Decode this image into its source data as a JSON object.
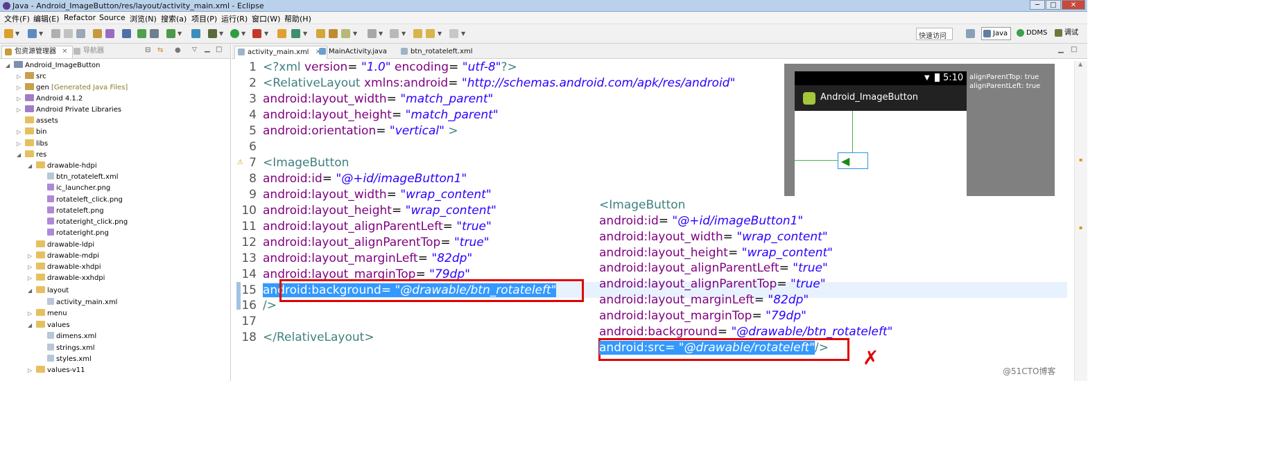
{
  "window": {
    "title": "Java - Android_ImageButton/res/layout/activity_main.xml - Eclipse",
    "min": "─",
    "max": "□",
    "close": "✕"
  },
  "menu": [
    "文件(F)",
    "编辑(E)",
    "Refactor",
    "Source",
    "浏览(N)",
    "搜索(a)",
    "项目(P)",
    "运行(R)",
    "窗口(W)",
    "帮助(H)"
  ],
  "toolbar": {
    "quick_access": "快速访问",
    "perspectives": {
      "java": "Java",
      "ddms": "DDMS",
      "debug": "调试"
    }
  },
  "left_panel": {
    "tabs": {
      "package_explorer": "包资源管理器",
      "navigator": "导航器"
    }
  },
  "tree": [
    {
      "label": "Android_ImageButton"
    },
    {
      "label": "src"
    },
    {
      "label": "gen",
      "deco": "[Generated Java Files]"
    },
    {
      "label": "Android 4.1.2"
    },
    {
      "label": "Android Private Libraries"
    },
    {
      "label": "assets"
    },
    {
      "label": "bin"
    },
    {
      "label": "libs"
    },
    {
      "label": "res"
    },
    {
      "label": "drawable-hdpi"
    },
    {
      "label": "btn_rotateleft.xml"
    },
    {
      "label": "ic_launcher.png"
    },
    {
      "label": "rotateleft_click.png"
    },
    {
      "label": "rotateleft.png"
    },
    {
      "label": "rotateright_click.png"
    },
    {
      "label": "rotateright.png"
    },
    {
      "label": "drawable-ldpi"
    },
    {
      "label": "drawable-mdpi"
    },
    {
      "label": "drawable-xhdpi"
    },
    {
      "label": "drawable-xxhdpi"
    },
    {
      "label": "layout"
    },
    {
      "label": "activity_main.xml"
    },
    {
      "label": "menu"
    },
    {
      "label": "values"
    },
    {
      "label": "dimens.xml"
    },
    {
      "label": "strings.xml"
    },
    {
      "label": "styles.xml"
    },
    {
      "label": "values-v11"
    }
  ],
  "editor": {
    "tabs": [
      "activity_main.xml",
      "MainActivity.java",
      "btn_rotateleft.xml"
    ],
    "lines": [
      {
        "n": "1",
        "p": [
          [
            "tag",
            "<?xml "
          ],
          [
            "attr",
            "version"
          ],
          [
            "p",
            "= "
          ],
          [
            "val",
            "\"1.0\""
          ],
          [
            "p",
            " "
          ],
          [
            "attr",
            "encoding"
          ],
          [
            "p",
            "= "
          ],
          [
            "val",
            "\"utf-8\""
          ],
          [
            "tag",
            "?>"
          ]
        ]
      },
      {
        "n": "2",
        "p": [
          [
            "tag",
            "<RelativeLayout "
          ],
          [
            "attr",
            "xmlns:android"
          ],
          [
            "p",
            "= "
          ],
          [
            "val",
            "\"http://schemas.android.com/apk/res/android\""
          ]
        ]
      },
      {
        "n": "3",
        "p": [
          [
            "attr",
            "   android:layout_width"
          ],
          [
            "p",
            "= "
          ],
          [
            "val",
            "\"match_parent\""
          ]
        ]
      },
      {
        "n": "4",
        "p": [
          [
            "attr",
            "   android:layout_height"
          ],
          [
            "p",
            "= "
          ],
          [
            "val",
            "\"match_parent\""
          ]
        ]
      },
      {
        "n": "5",
        "p": [
          [
            "attr",
            "   android:orientation"
          ],
          [
            "p",
            "= "
          ],
          [
            "val",
            "\"vertical\""
          ],
          [
            "tag",
            " >"
          ]
        ]
      },
      {
        "n": "6",
        "p": []
      },
      {
        "n": "7",
        "p": [
          [
            "tag",
            "    <ImageButton"
          ]
        ]
      },
      {
        "n": "8",
        "p": [
          [
            "attr",
            "       android:id"
          ],
          [
            "p",
            "= "
          ],
          [
            "val",
            "\"@+id/imageButton1\""
          ]
        ]
      },
      {
        "n": "9",
        "p": [
          [
            "attr",
            "       android:layout_width"
          ],
          [
            "p",
            "= "
          ],
          [
            "val",
            "\"wrap_content\""
          ]
        ]
      },
      {
        "n": "10",
        "p": [
          [
            "attr",
            "       android:layout_height"
          ],
          [
            "p",
            "= "
          ],
          [
            "val",
            "\"wrap_content\""
          ]
        ]
      },
      {
        "n": "11",
        "p": [
          [
            "attr",
            "       android:layout_alignParentLeft"
          ],
          [
            "p",
            "= "
          ],
          [
            "val",
            "\"true\""
          ]
        ]
      },
      {
        "n": "12",
        "p": [
          [
            "attr",
            "       android:layout_alignParentTop"
          ],
          [
            "p",
            "= "
          ],
          [
            "val",
            "\"true\""
          ]
        ]
      },
      {
        "n": "13",
        "p": [
          [
            "attr",
            "       android:layout_marginLeft"
          ],
          [
            "p",
            "= "
          ],
          [
            "val",
            "\"82dp\""
          ]
        ]
      },
      {
        "n": "14",
        "p": [
          [
            "attr",
            "       android:layout_marginTop"
          ],
          [
            "p",
            "= "
          ],
          [
            "val",
            "\"79dp\""
          ]
        ]
      },
      {
        "n": "15",
        "p": [
          [
            "attr",
            "       android:background"
          ],
          [
            "p",
            "= "
          ],
          [
            "val",
            "\"@drawable/btn_rotateleft\""
          ]
        ]
      },
      {
        "n": "16",
        "p": [
          [
            "tag",
            "       />"
          ]
        ]
      },
      {
        "n": "17",
        "p": []
      },
      {
        "n": "18",
        "p": [
          [
            "tag",
            "</RelativeLayout>"
          ]
        ]
      }
    ]
  },
  "overlay": {
    "lines": [
      [
        [
          "tag",
          "<ImageButton"
        ]
      ],
      [
        [
          "attr",
          "   android:id"
        ],
        [
          "p",
          "= "
        ],
        [
          "val",
          "\"@+id/imageButton1\""
        ]
      ],
      [
        [
          "attr",
          "   android:layout_width"
        ],
        [
          "p",
          "= "
        ],
        [
          "val",
          "\"wrap_content\""
        ]
      ],
      [
        [
          "attr",
          "   android:layout_height"
        ],
        [
          "p",
          "= "
        ],
        [
          "val",
          "\"wrap_content\""
        ]
      ],
      [
        [
          "attr",
          "   android:layout_alignParentLeft"
        ],
        [
          "p",
          "= "
        ],
        [
          "val",
          "\"true\""
        ]
      ],
      [
        [
          "attr",
          "   android:layout_alignParentTop"
        ],
        [
          "p",
          "= "
        ],
        [
          "val",
          "\"true\""
        ]
      ],
      [
        [
          "attr",
          "   android:layout_marginLeft"
        ],
        [
          "p",
          "= "
        ],
        [
          "val",
          "\"82dp\""
        ]
      ],
      [
        [
          "attr",
          "   android:layout_marginTop"
        ],
        [
          "p",
          "= "
        ],
        [
          "val",
          "\"79dp\""
        ]
      ],
      [
        [
          "attr",
          "   android:background"
        ],
        [
          "p",
          "= "
        ],
        [
          "val",
          "\"@drawable/btn_rotateleft\""
        ]
      ],
      [
        [
          "attr",
          "   android:src"
        ],
        [
          "p",
          "= "
        ],
        [
          "val",
          "\"@drawable/rotateleft\""
        ],
        [
          "tag",
          "/>"
        ]
      ]
    ],
    "mark": "✗"
  },
  "preview": {
    "time": "5:10",
    "app_title": "Android_ImageButton",
    "info1": "alignParentTop: true",
    "info2": "alignParentLeft: true"
  },
  "watermark": "@51CTO博客",
  "colors": {
    "tag": "#3f7f7f",
    "attr": "#7f007f",
    "value": "#2a00ff",
    "selection": "#3399ff",
    "highlight_box": "#e00000"
  }
}
